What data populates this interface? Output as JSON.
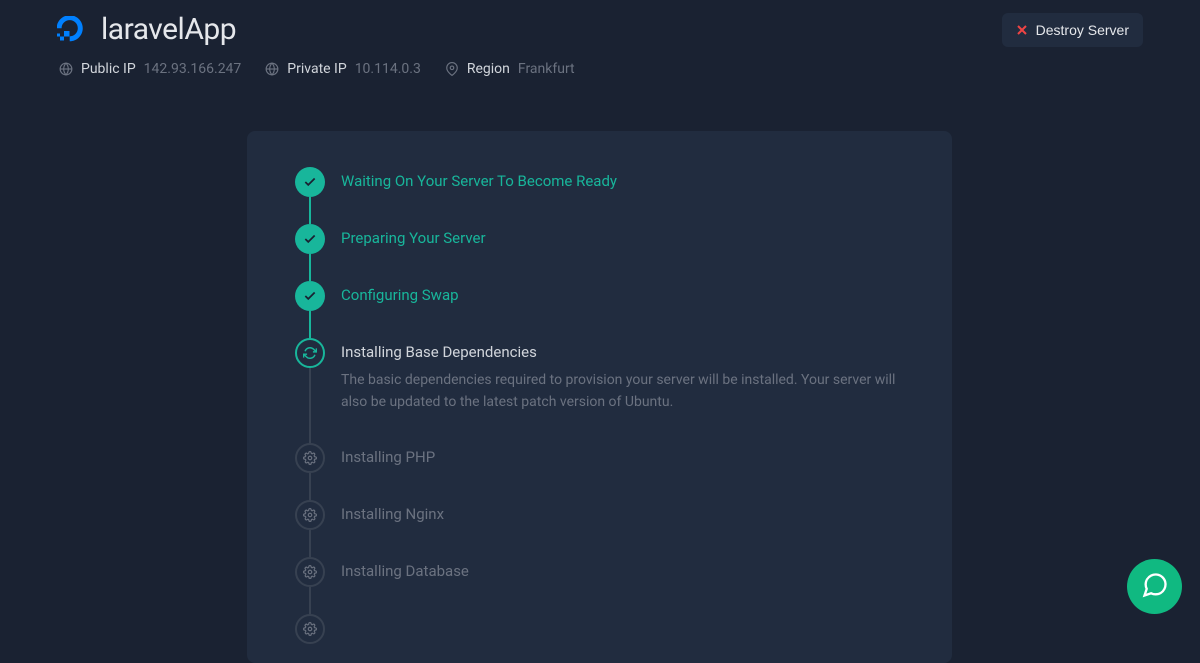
{
  "header": {
    "app_title": "laravelApp",
    "destroy_label": "Destroy Server"
  },
  "meta": {
    "public_ip_label": "Public IP",
    "public_ip_value": "142.93.166.247",
    "private_ip_label": "Private IP",
    "private_ip_value": "10.114.0.3",
    "region_label": "Region",
    "region_value": "Frankfurt"
  },
  "steps": [
    {
      "title": "Waiting On Your Server To Become Ready",
      "status": "done"
    },
    {
      "title": "Preparing Your Server",
      "status": "done"
    },
    {
      "title": "Configuring Swap",
      "status": "done"
    },
    {
      "title": "Installing Base Dependencies",
      "status": "progress",
      "desc": "The basic dependencies required to provision your server will be installed. Your server will also be updated to the latest patch version of Ubuntu."
    },
    {
      "title": "Installing PHP",
      "status": "pending"
    },
    {
      "title": "Installing Nginx",
      "status": "pending"
    },
    {
      "title": "Installing Database",
      "status": "pending"
    }
  ],
  "colors": {
    "accent": "#18b69b",
    "bg": "#1a2232",
    "card": "#212c3f"
  }
}
